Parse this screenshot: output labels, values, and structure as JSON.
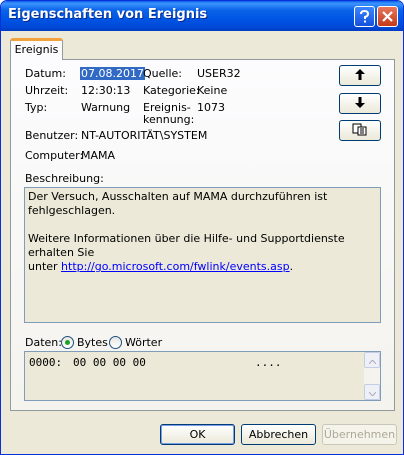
{
  "window": {
    "title": "Eigenschaften von Ereignis"
  },
  "titlebar_buttons": {
    "help_icon": "question-mark-icon",
    "close_icon": "close-x-icon"
  },
  "tab": {
    "label": "Ereignis"
  },
  "fields": {
    "datum_label": "Datum:",
    "datum_value": "07.08.2017",
    "quelle_label": "Quelle:",
    "quelle_value": "USER32",
    "uhrzeit_label": "Uhrzeit:",
    "uhrzeit_value": "12:30:13",
    "kategorie_label": "Kategorie:",
    "kategorie_value": "Keine",
    "typ_label": "Typ:",
    "typ_value": "Warnung",
    "ereignis_label_1": "Ereignis-",
    "ereignis_label_2": "kennung:",
    "ereignis_value": "1073",
    "benutzer_label": "Benutzer:",
    "benutzer_value": "NT-AUTORITÄT\\SYSTEM",
    "computer_label": "Computer:",
    "computer_value": "MAMA"
  },
  "nav": {
    "up_icon": "arrow-up-icon",
    "down_icon": "arrow-down-icon",
    "copy_icon": "copy-icon"
  },
  "description": {
    "label": "Beschreibung:",
    "line1": "Der Versuch, Ausschalten auf MAMA durchzuführen ist fehlgeschlagen.",
    "line2": "Weitere Informationen über die Hilfe- und Supportdienste erhalten Sie",
    "line3_prefix": "unter ",
    "link": "http://go.microsoft.com/fwlink/events.asp",
    "line3_suffix": "."
  },
  "data": {
    "label": "Daten:",
    "option_bytes": "Bytes",
    "option_words": "Wörter",
    "selected": "Bytes",
    "row_offset": "0000:",
    "row_bytes": "00 00 00 00",
    "row_ascii": "...."
  },
  "buttons": {
    "ok": "OK",
    "cancel": "Abbrechen",
    "apply": "Übernehmen"
  },
  "colors": {
    "title_blue": "#0055e5",
    "selection": "#316ac5",
    "tab_accent": "#f1a23c"
  }
}
